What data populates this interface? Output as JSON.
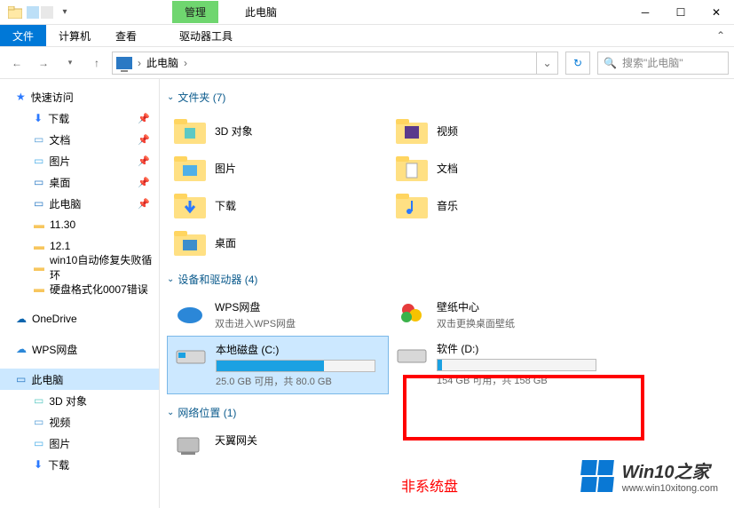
{
  "titlebar": {
    "ribbon_context": "管理",
    "window_title": "此电脑"
  },
  "ribbon_tabs": {
    "file": "文件",
    "computer": "计算机",
    "view": "查看",
    "drive_tools": "驱动器工具"
  },
  "navbar": {
    "breadcrumb": "此电脑",
    "search_placeholder": "搜索\"此电脑\""
  },
  "sidebar": {
    "quick_access": "快速访问",
    "downloads": "下载",
    "documents": "文档",
    "pictures": "图片",
    "desktop": "桌面",
    "this_pc": "此电脑",
    "f_1130": "11.30",
    "f_121": "12.1",
    "f_win10": "win10自动修复失败循环",
    "f_disk": "硬盘格式化0007错误",
    "onedrive": "OneDrive",
    "wps": "WPS网盘",
    "this_pc2": "此电脑",
    "3d": "3D 对象",
    "video": "视频",
    "pictures2": "图片",
    "downloads2": "下载"
  },
  "groups": {
    "folders_header": "文件夹 (7)",
    "devices_header": "设备和驱动器 (4)",
    "network_header": "网络位置 (1)"
  },
  "folders": {
    "3d": "3D 对象",
    "video": "视频",
    "pictures": "图片",
    "documents": "文档",
    "downloads": "下载",
    "music": "音乐",
    "desktop": "桌面"
  },
  "devices": {
    "wps_name": "WPS网盘",
    "wps_sub": "双击进入WPS网盘",
    "wallpaper_name": "壁纸中心",
    "wallpaper_sub": "双击更换桌面壁纸",
    "c_name": "本地磁盘 (C:)",
    "c_sub": "25.0 GB 可用，共 80.0 GB",
    "c_pct": 68,
    "d_name": "软件 (D:)",
    "d_sub": "154 GB 可用，共 158 GB",
    "d_pct": 3
  },
  "network": {
    "twy": "天翼网关"
  },
  "annotation": {
    "red_text": "非系统盘"
  },
  "watermark": {
    "brand": "Win10之家",
    "url": "www.win10xitong.com"
  }
}
